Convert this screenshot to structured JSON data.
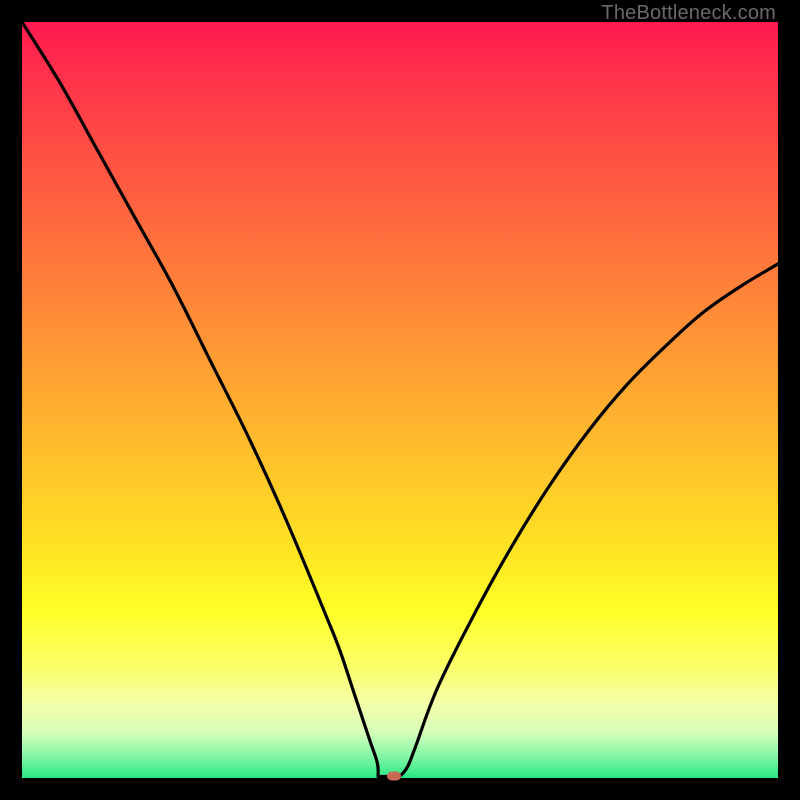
{
  "watermark": "TheBottleneck.com",
  "colors": {
    "frame": "#000000",
    "curve": "#000000",
    "marker": "#c96a56"
  },
  "chart_data": {
    "type": "line",
    "title": "",
    "xlabel": "",
    "ylabel": "",
    "xlim": [
      0,
      100
    ],
    "ylim": [
      0,
      100
    ],
    "grid": false,
    "legend": false,
    "series": [
      {
        "name": "curve",
        "x": [
          0,
          5,
          10,
          15,
          20,
          25,
          30,
          35,
          40,
          42,
          44,
          46,
          47,
          48,
          48.5,
          49,
          50,
          51,
          52,
          55,
          60,
          65,
          70,
          75,
          80,
          85,
          90,
          95,
          100
        ],
        "y": [
          100,
          92,
          83,
          74,
          65,
          55,
          45,
          34,
          22,
          17,
          11,
          5,
          2,
          0.5,
          0.2,
          0.2,
          0.3,
          1.5,
          4,
          12,
          22,
          31,
          39,
          46,
          52,
          57,
          61.5,
          65,
          68
        ]
      }
    ],
    "marker": {
      "x": 49.2,
      "y": 0.2
    },
    "flat_min": {
      "x_start": 47.1,
      "x_end": 49.0,
      "y": 0.2
    }
  }
}
